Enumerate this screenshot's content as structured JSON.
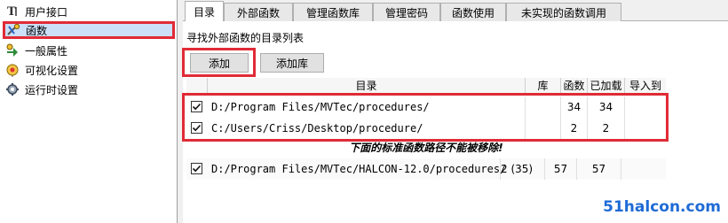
{
  "sidebar": {
    "items": [
      {
        "label": "用户接口",
        "icon": "text-cursor-icon"
      },
      {
        "label": "函数",
        "icon": "function-tools-icon"
      },
      {
        "label": "一般属性",
        "icon": "properties-arrow-icon"
      },
      {
        "label": "可视化设置",
        "icon": "visualization-icon"
      },
      {
        "label": "运行时设置",
        "icon": "runtime-gear-icon"
      }
    ],
    "selected_index": 1
  },
  "tabs": [
    {
      "label": "目录",
      "active": true
    },
    {
      "label": "外部函数"
    },
    {
      "label": "管理函数库"
    },
    {
      "label": "管理密码"
    },
    {
      "label": "函数使用"
    },
    {
      "label": "未实现的函数调用"
    }
  ],
  "main": {
    "caption": "寻找外部函数的目录列表",
    "add_button": "添加",
    "add_library_button": "添加库",
    "table": {
      "columns": [
        "目录",
        "库",
        "函数",
        "已加载",
        "导入到"
      ],
      "rows": [
        {
          "checked": true,
          "dir": "D:/Program Files/MVTec/procedures/",
          "lib": "",
          "funcs": "34",
          "loaded": "34",
          "import": ""
        },
        {
          "checked": true,
          "dir": "C:/Users/Criss/Desktop/procedure/",
          "lib": "",
          "funcs": "2",
          "loaded": "2",
          "import": ""
        }
      ],
      "note": "下面的标准函数路径不能被移除!",
      "standard_rows": [
        {
          "checked": true,
          "dir": "D:/Program Files/MVTec/HALCON-12.0/procedures/",
          "lib": "2 (35)",
          "funcs": "57",
          "loaded": "57",
          "import": ""
        }
      ]
    }
  },
  "watermark": "51halcon.com",
  "colors": {
    "highlight": "#e02b36",
    "selection": "#cce0f7",
    "watermark": "#1e6bd6"
  }
}
